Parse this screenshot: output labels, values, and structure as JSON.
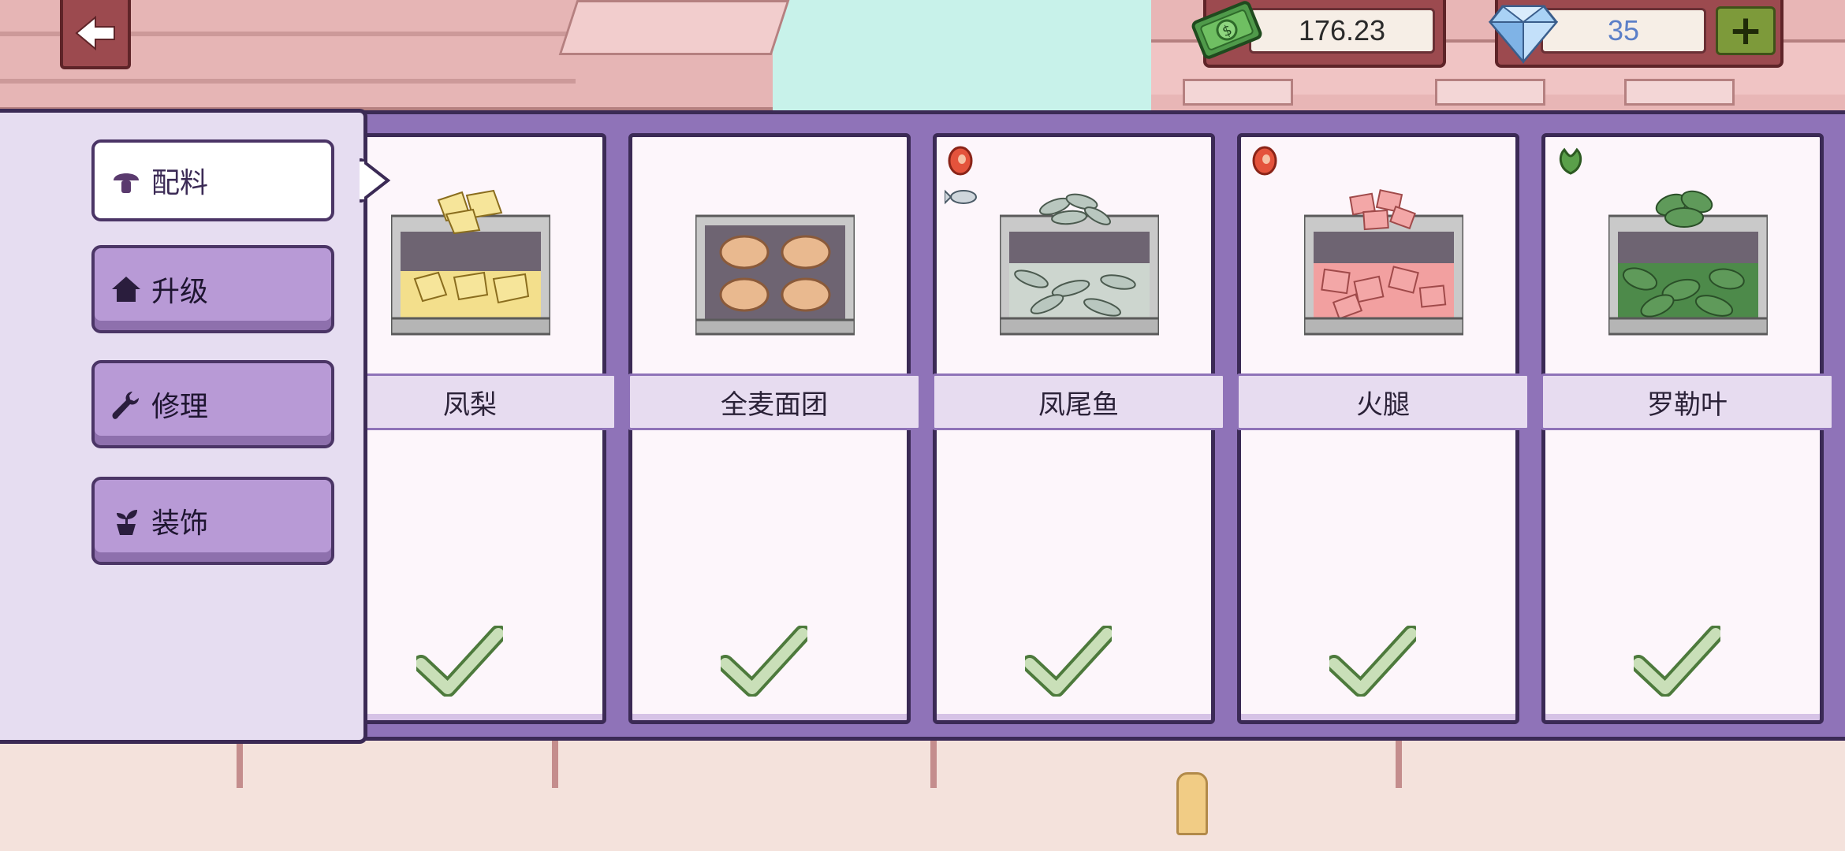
{
  "hud": {
    "money": "176.23",
    "gems": "35",
    "plus_label": "+"
  },
  "sidebar": {
    "items": [
      {
        "label": "配料",
        "icon": "mushroom-icon",
        "active": true
      },
      {
        "label": "升级",
        "icon": "house-icon",
        "active": false
      },
      {
        "label": "修理",
        "icon": "wrench-icon",
        "active": false
      },
      {
        "label": "装饰",
        "icon": "plant-pot-icon",
        "active": false
      }
    ]
  },
  "ingredients": [
    {
      "name": "凤梨",
      "food": "pineapple-chunks",
      "tags": [],
      "purchased": true
    },
    {
      "name": "全麦面团",
      "food": "wheat-dough-balls",
      "tags": [],
      "purchased": true
    },
    {
      "name": "凤尾鱼",
      "food": "anchovies",
      "tags": [
        "meat-icon",
        "fish-icon"
      ],
      "purchased": true
    },
    {
      "name": "火腿",
      "food": "ham-cubes",
      "tags": [
        "meat-icon"
      ],
      "purchased": true
    },
    {
      "name": "罗勒叶",
      "food": "basil-leaves",
      "tags": [
        "vegetable-icon"
      ],
      "purchased": true
    }
  ],
  "colors": {
    "panel": "#8f73b8",
    "menu_button": "#b89ad6",
    "outline": "#3b2a55",
    "check": "#c9dfb8",
    "hud_frame": "#9c4a4f"
  }
}
